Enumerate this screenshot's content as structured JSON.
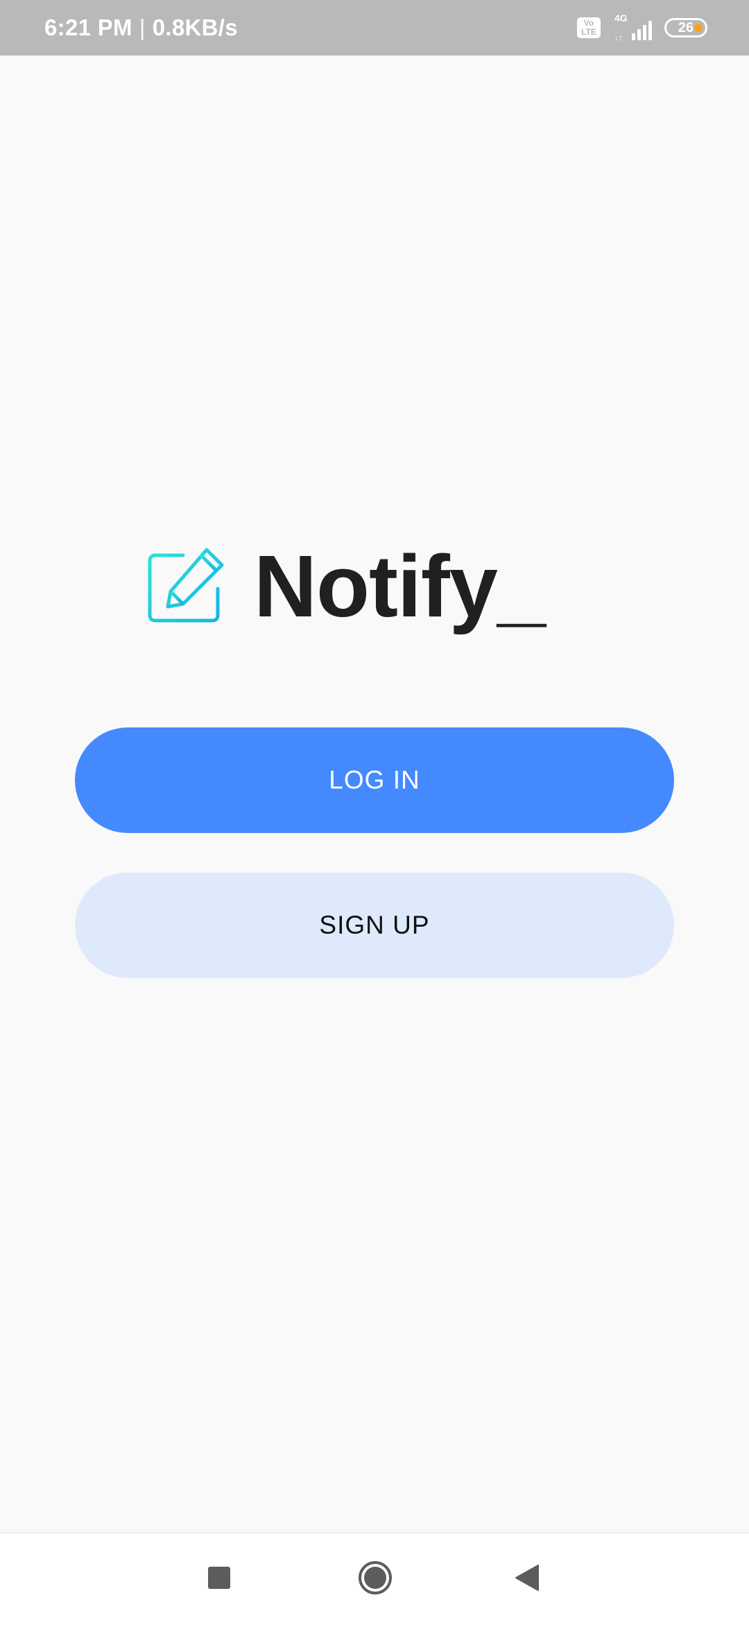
{
  "status_bar": {
    "time": "6:21 PM",
    "separator": "|",
    "network_speed": "0.8KB/s",
    "volte_line1": "Vo",
    "volte_line2": "LTE",
    "network_type": "4G",
    "network_arrows": "↓↑",
    "battery_level": "26",
    "battery_dot_color": "#f6a21f"
  },
  "app": {
    "name": "Notify_",
    "logo_icon": "edit-note-icon",
    "accent_color": "#20c8d8"
  },
  "buttons": {
    "login_label": "LOG IN",
    "login_color": "#448afe",
    "signup_label": "SIGN UP",
    "signup_color": "#deeafc"
  },
  "nav_bar": {
    "recent_icon": "square-icon",
    "home_icon": "circle-icon",
    "back_icon": "triangle-back-icon"
  }
}
